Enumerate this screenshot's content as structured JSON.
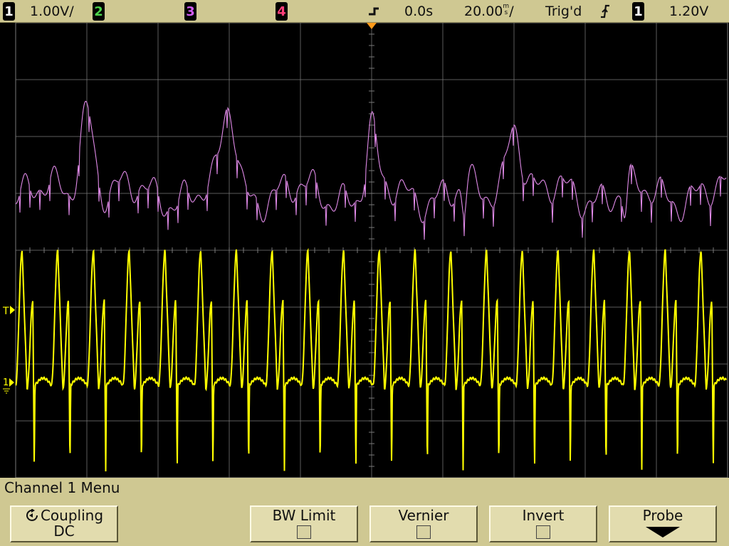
{
  "status": {
    "ch1_badge": "1",
    "ch1_scale": "1.00V/",
    "ch2_badge": "2",
    "ch3_badge": "3",
    "ch4_badge": "4",
    "time_delay": "0.0s",
    "timebase_value": "20.00",
    "timebase_unit_num": "m",
    "timebase_unit_den": "s",
    "timebase_suffix": "/",
    "trigger_status": "Trig'd",
    "trigger_slope_icon": "rising-edge-icon",
    "trigger_source_badge": "1",
    "trigger_level": "1.20V"
  },
  "markers": {
    "trigger_level_marker": "T",
    "channel_ground_marker": "1"
  },
  "menu": {
    "title": "Channel 1  Menu",
    "softkeys": [
      {
        "label": "Coupling",
        "value": "DC",
        "icon": "cycle-arrow-icon"
      },
      {
        "label": "BW Limit",
        "checked": false
      },
      {
        "label": "Vernier",
        "checked": false
      },
      {
        "label": "Invert",
        "checked": false
      },
      {
        "label": "Probe",
        "icon": "down-arrow-icon"
      }
    ]
  },
  "colors": {
    "channel1": "#ffff00",
    "math_fft": "#e08ae8",
    "graticule": "#7a7a7a",
    "trigger_marker": "#ff9a1a",
    "bezel": "#cfc892"
  }
}
